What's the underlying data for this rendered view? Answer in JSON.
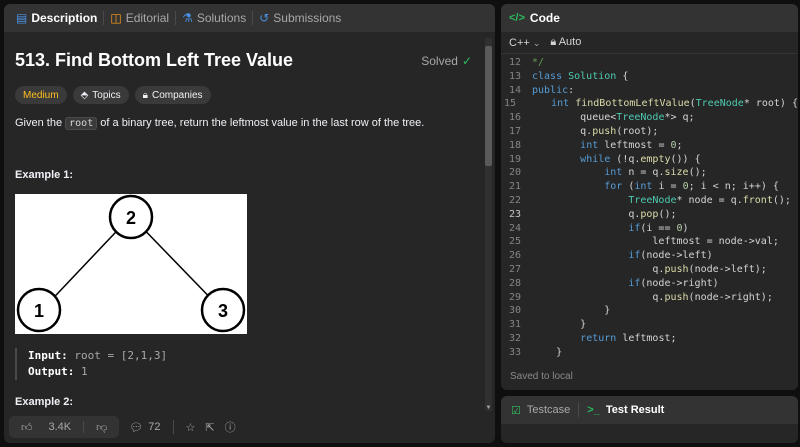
{
  "tabs": {
    "description": "Description",
    "editorial": "Editorial",
    "solutions": "Solutions",
    "submissions": "Submissions"
  },
  "problem": {
    "title": "513. Find Bottom Left Tree Value",
    "status": "Solved",
    "difficulty": "Medium",
    "topics_label": "Topics",
    "companies_label": "Companies",
    "desc_before": "Given the ",
    "desc_code": "root",
    "desc_after": " of a binary tree, return the leftmost value in the last row of the tree.",
    "example1_title": "Example 1:",
    "example2_title": "Example 2:",
    "tree_nodes": [
      "2",
      "1",
      "3"
    ],
    "input_label": "Input:",
    "input_value": "root = [2,1,3]",
    "output_label": "Output:",
    "output_value": "1"
  },
  "footer": {
    "likes": "3.4K",
    "comments": "72"
  },
  "code_panel": {
    "title": "Code",
    "language": "C++",
    "mode": "Auto",
    "saved_text": "Saved to local",
    "current_line": 23
  },
  "bottom": {
    "testcase": "Testcase",
    "test_result": "Test Result"
  },
  "colors": {
    "accent_green": "#2cbb5d",
    "medium": "#ffc01e",
    "panel": "#262626",
    "background": "#0f0f0f"
  }
}
